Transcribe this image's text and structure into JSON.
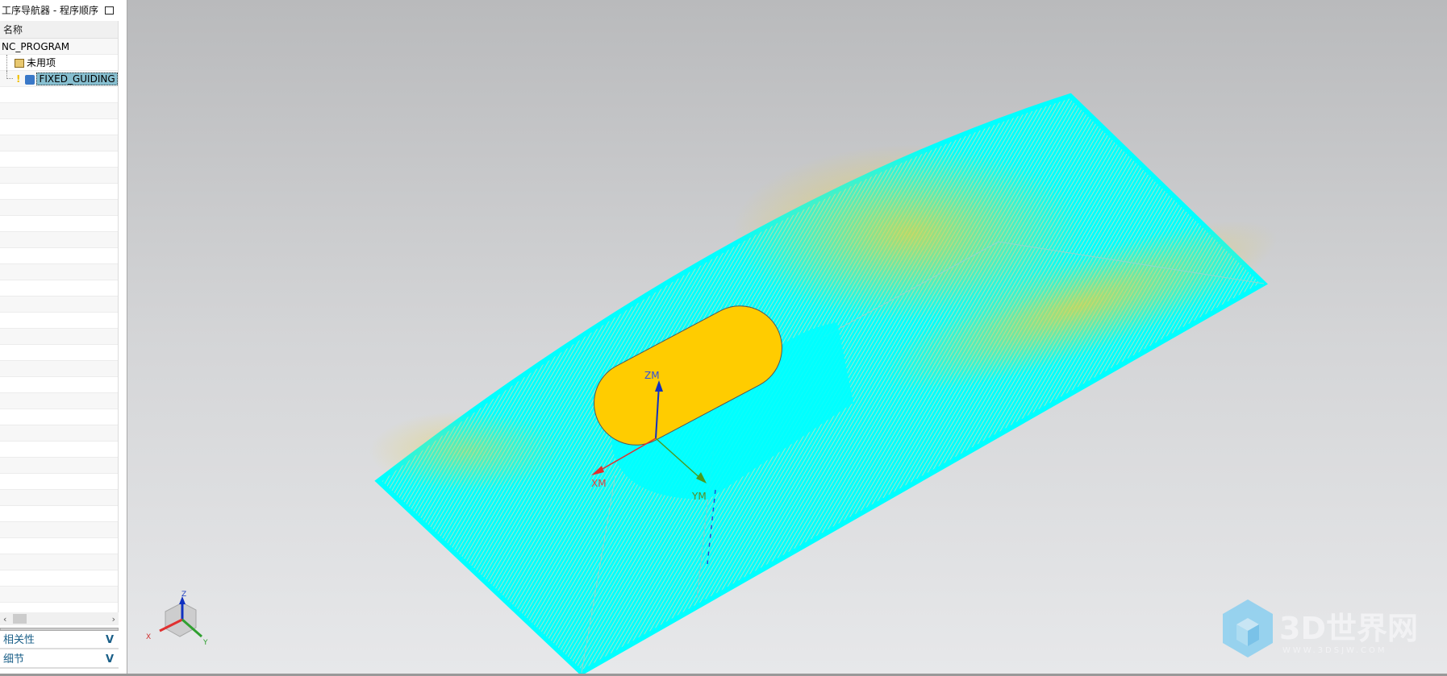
{
  "navigator": {
    "title": "工序导航器 - 程序顺序",
    "column_header": "名称",
    "items": [
      {
        "label": "NC_PROGRAM",
        "icon": "program-root"
      },
      {
        "label": "未用项",
        "icon": "folder-icon"
      },
      {
        "label": "FIXED_GUIDING",
        "icon": "operation-icon",
        "status": "warning",
        "selected": true
      }
    ],
    "sections": [
      {
        "label": "相关性"
      },
      {
        "label": "细节"
      }
    ]
  },
  "viewport": {
    "axes": {
      "zm": "ZM",
      "xm": "XM",
      "ym": "YM"
    },
    "triad": {
      "x": "X",
      "y": "Y",
      "z": "Z"
    },
    "colors": {
      "part": "#00ffff",
      "toolpath": "#ffcc00",
      "slot": "#ffcc00"
    }
  },
  "watermark": {
    "title": "3D世界网",
    "url": "WWW.3DSJW.COM"
  }
}
